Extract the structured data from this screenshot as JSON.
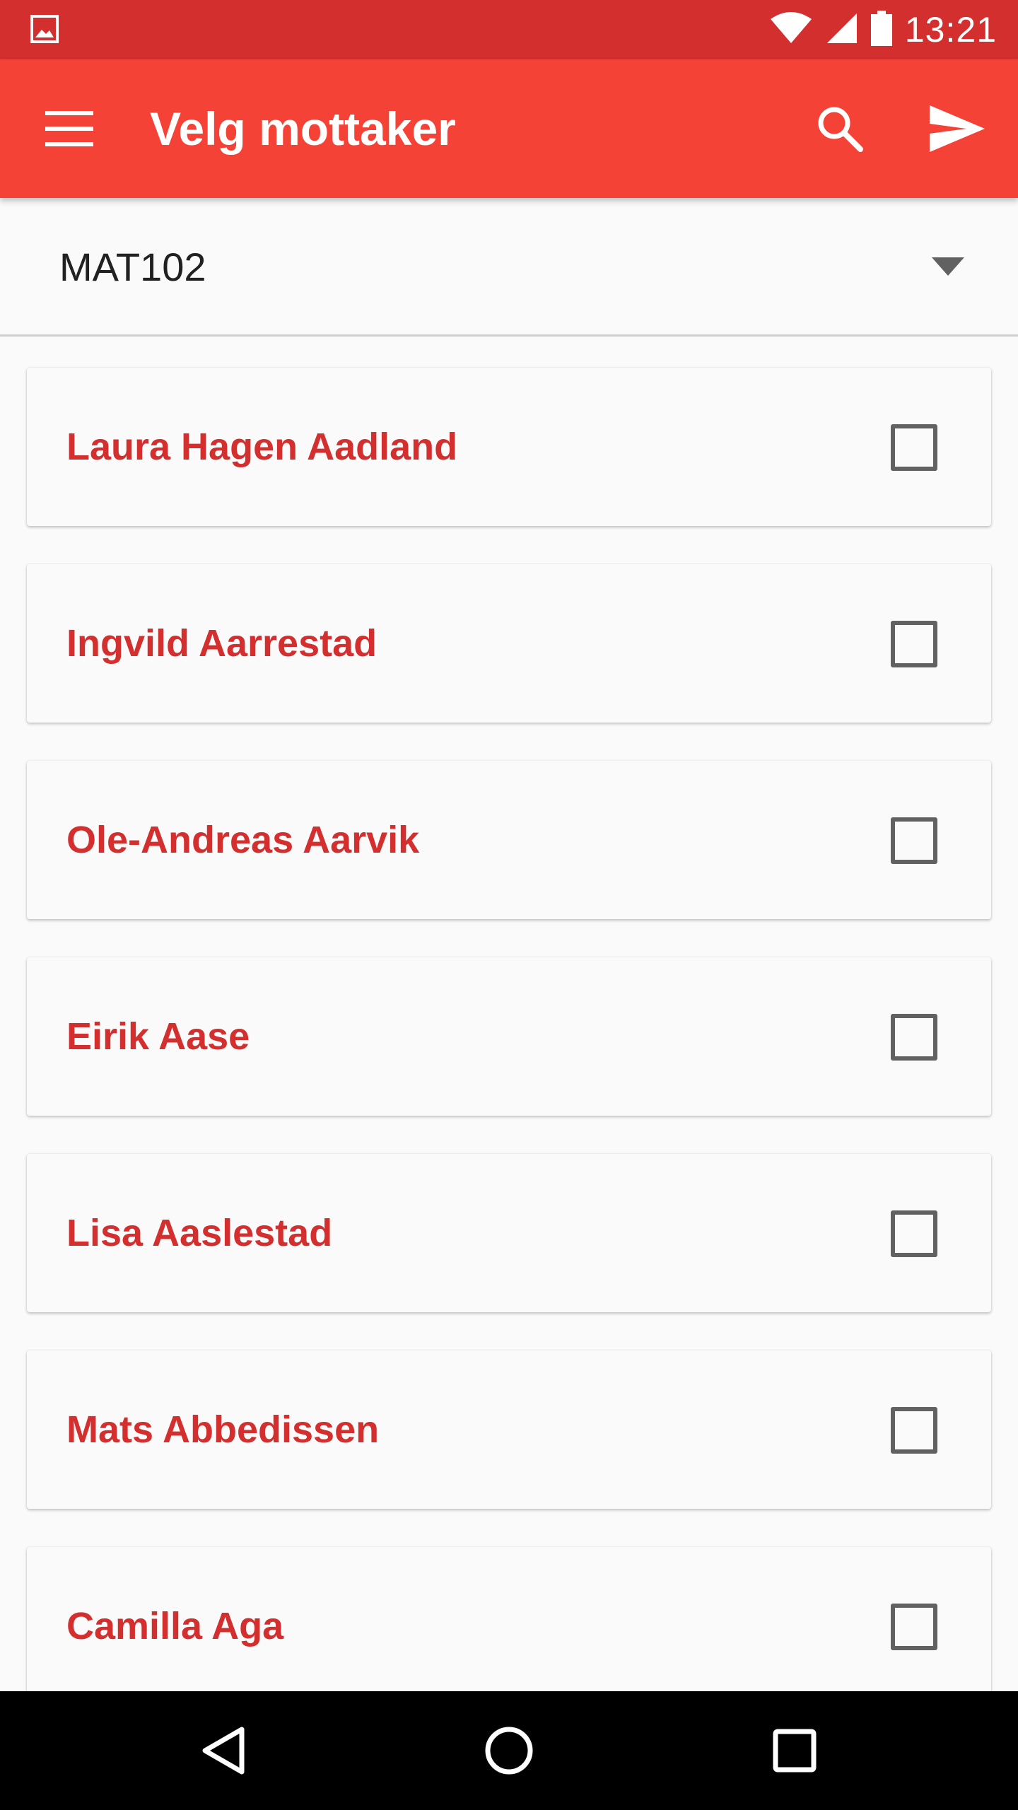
{
  "status_bar": {
    "time": "13:21",
    "icons": [
      "gallery-icon",
      "wifi-icon",
      "signal-icon",
      "battery-icon"
    ]
  },
  "app_bar": {
    "title": "Velg mottaker",
    "icons": [
      "menu-icon",
      "search-icon",
      "send-icon"
    ],
    "color": "#f44336"
  },
  "spinner": {
    "selected": "MAT102"
  },
  "recipients": [
    {
      "name": "Laura Hagen Aadland",
      "checked": false
    },
    {
      "name": "Ingvild Aarrestad",
      "checked": false
    },
    {
      "name": "Ole-Andreas Aarvik",
      "checked": false
    },
    {
      "name": "Eirik Aase",
      "checked": false
    },
    {
      "name": "Lisa Aaslestad",
      "checked": false
    },
    {
      "name": "Mats Abbedissen",
      "checked": false
    },
    {
      "name": "Camilla Aga",
      "checked": false
    }
  ],
  "nav_bar": {
    "icons": [
      "back-icon",
      "home-icon",
      "recents-icon"
    ]
  },
  "colors": {
    "status_bar": "#d32f2f",
    "accent_text": "#d32f2f",
    "background": "#fafafa"
  }
}
